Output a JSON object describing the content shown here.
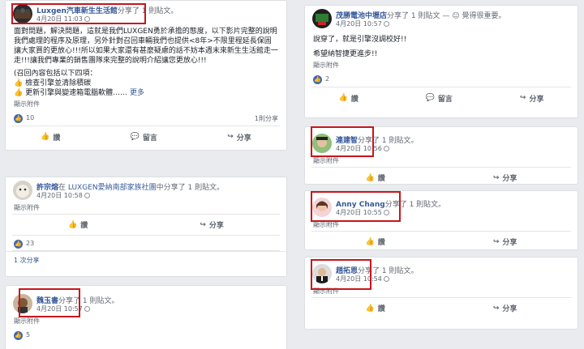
{
  "actions": {
    "like": "讚",
    "comment": "留言",
    "share": "分享"
  },
  "see_translation": "顯示附件",
  "colors": {
    "highlight": "#c8151d",
    "link": "#365899",
    "like_badge": "#4267b2"
  },
  "left": {
    "post1": {
      "author": "Luxgen汽車新生生活館",
      "shared": "分享了 1 則貼文。",
      "time": "4月20日 11:03",
      "body": [
        "面對問題，解決問題，這就是我們LUXGEN勇於承擔的態度，以下影片完整的說明我們處理的程序及原理，另外針對召回車輛我們也提供<8年>不限里程延長保固讓大家買的更放心!!!所以如果大家還有甚麼疑慮的話不妨本週末來新生生活館走一走!!!讓我們專業的銷售團隊來完整的說明介紹讓您更放心!!!",
        "(召回內容包括以下四項：",
        "👍 檢查引擎並清除積碳",
        "👍 更新引擎與變速箱電腦軟體……"
      ],
      "see_more": "更多",
      "likes": "10",
      "shares": "1則分享"
    },
    "post2": {
      "author": "許宗熔",
      "in_text": "在",
      "group": "LUXGEN愛納南部家族社團",
      "shared": "中分享了 1 則貼文。",
      "time": "4月20日 10:58",
      "likes": "23",
      "comments_link": "1 次分享"
    },
    "post3": {
      "author": "魏玉書",
      "shared": "分享了 1 則貼文。",
      "time": "4月20日 10:57",
      "likes": "5"
    }
  },
  "right": {
    "post1": {
      "author": "茂勝電池中壢店",
      "shared": "分享了 1 則貼文 —",
      "feeling": "覺得很重要。",
      "time": "4月20日 10:57",
      "body": [
        "說穿了，就是引擎沒調校好!!",
        "希望納智捷更進步!!"
      ],
      "likes": "2"
    },
    "post2": {
      "author": "連建智",
      "shared": "分享了 1 則貼文。",
      "time": "4月20日 10:56"
    },
    "post3": {
      "author": "Anny Chang",
      "shared": "分享了 1 則貼文。",
      "time": "4月20日 10:55"
    },
    "post4": {
      "author": "趙拓恩",
      "shared": "分享了 1 則貼文。",
      "time": "4月20日 10:54"
    }
  }
}
